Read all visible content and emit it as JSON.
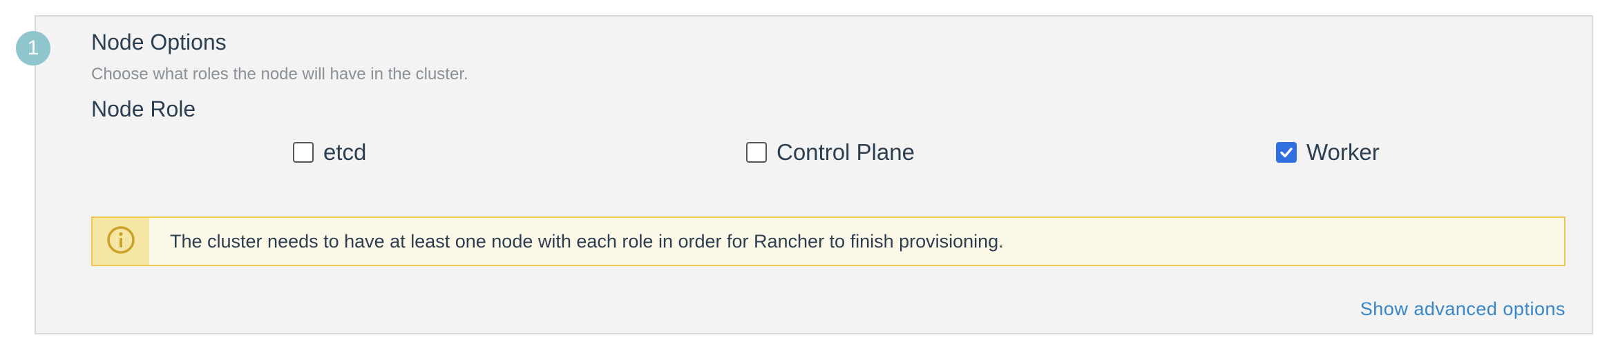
{
  "step": {
    "number": "1"
  },
  "section": {
    "title": "Node Options",
    "subtitle": "Choose what roles the node will have in the cluster."
  },
  "node_role": {
    "label": "Node Role",
    "options": [
      {
        "label": "etcd",
        "checked": false
      },
      {
        "label": "Control Plane",
        "checked": false
      },
      {
        "label": "Worker",
        "checked": true
      }
    ]
  },
  "alert": {
    "icon": "info-circle-icon",
    "message": "The cluster needs to have at least one node with each role in order for Rancher to finish provisioning.",
    "colors": {
      "border": "#f0c850",
      "background": "#fcf8e8",
      "icon": "#c9a227"
    }
  },
  "advanced": {
    "link_label": "Show advanced options"
  },
  "colors": {
    "accent_badge": "#8fc6cd",
    "checkbox_checked": "#2f6fe0",
    "link": "#3a87c7"
  }
}
